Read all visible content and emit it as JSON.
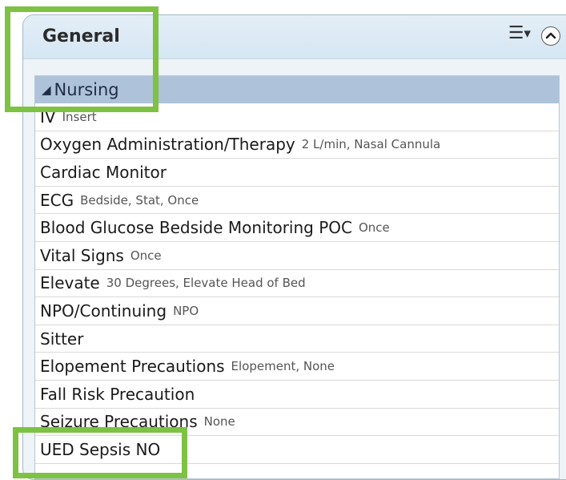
{
  "panel": {
    "title": "General",
    "menu_icon": "hamburger-menu-icon",
    "collapse_icon": "chevron-up-circle-icon"
  },
  "group": {
    "label": "Nursing",
    "expander_icon": "triangle-expanded-icon"
  },
  "orders": [
    {
      "title": "IV",
      "detail": "Insert"
    },
    {
      "title": "Oxygen Administration/Therapy",
      "detail": "2 L/min, Nasal Cannula"
    },
    {
      "title": "Cardiac Monitor",
      "detail": ""
    },
    {
      "title": "ECG",
      "detail": "Bedside, Stat, Once"
    },
    {
      "title": "Blood Glucose Bedside Monitoring POC",
      "detail": "Once"
    },
    {
      "title": "Vital Signs",
      "detail": "Once"
    },
    {
      "title": "Elevate",
      "detail": "30 Degrees, Elevate Head of Bed"
    },
    {
      "title": "NPO/Continuing",
      "detail": "NPO"
    },
    {
      "title": "Sitter",
      "detail": ""
    },
    {
      "title": "Elopement Precautions",
      "detail": "Elopement, None"
    },
    {
      "title": "Fall Risk Precaution",
      "detail": ""
    },
    {
      "title": "Seizure Precautions",
      "detail": "None"
    },
    {
      "title": "UED Sepsis NO",
      "detail": ""
    }
  ],
  "colors": {
    "highlight": "#7dc243",
    "group_header_bg": "#aec2da",
    "panel_header_bg": "#d6e6f3"
  }
}
